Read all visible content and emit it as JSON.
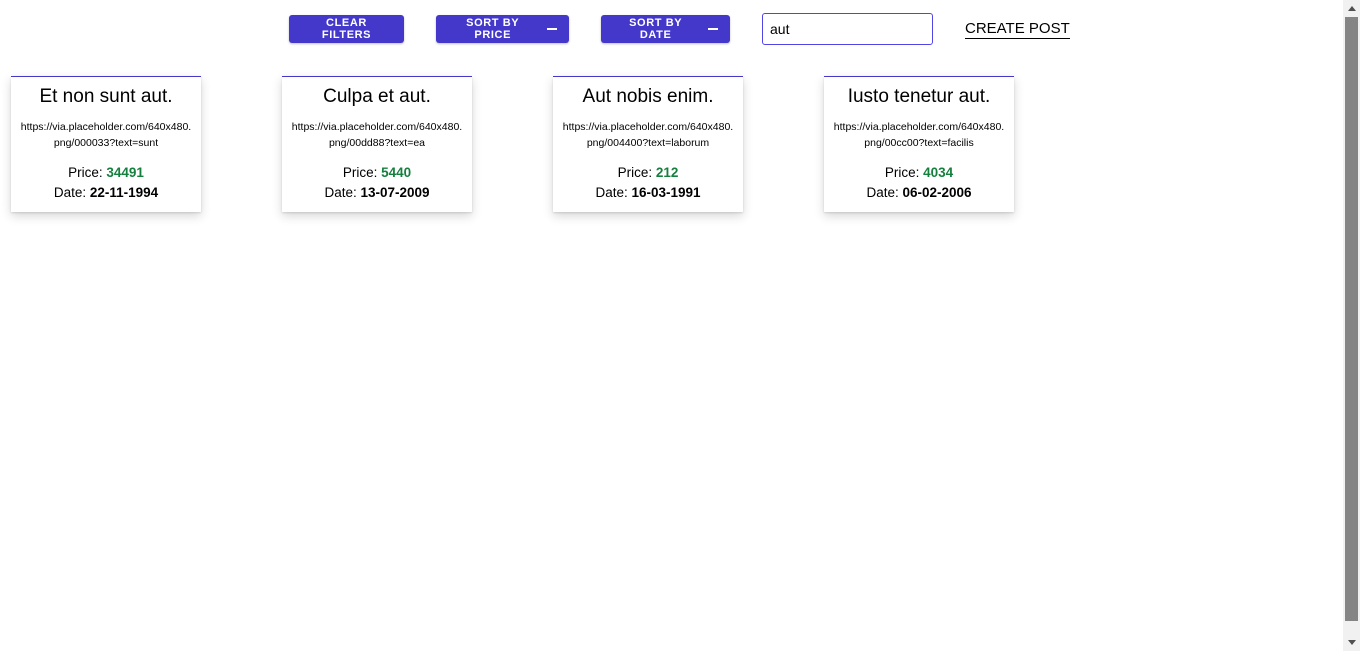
{
  "colors": {
    "button_bg": "#4338ca",
    "price_value": "#15803d",
    "search_border": "#4f46e5",
    "card_accent": "#4338ca"
  },
  "toolbar": {
    "clear_label": "CLEAR FILTERS",
    "sort_price_label": "SORT BY PRICE",
    "sort_date_label": "SORT BY DATE",
    "search_value": "aut",
    "create_label": "CREATE POST"
  },
  "cards": [
    {
      "title": "Et non sunt aut.",
      "url": "https://via.placeholder.com/640x480.png/000033?text=sunt",
      "price_label": "Price: ",
      "price": "34491",
      "date_label": "Date: ",
      "date": "22-11-1994"
    },
    {
      "title": "Culpa et aut.",
      "url": "https://via.placeholder.com/640x480.png/00dd88?text=ea",
      "price_label": "Price: ",
      "price": "5440",
      "date_label": "Date: ",
      "date": "13-07-2009"
    },
    {
      "title": "Aut nobis enim.",
      "url": "https://via.placeholder.com/640x480.png/004400?text=laborum",
      "price_label": "Price: ",
      "price": "212",
      "date_label": "Date: ",
      "date": "16-03-1991"
    },
    {
      "title": "Iusto tenetur aut.",
      "url": "https://via.placeholder.com/640x480.png/00cc00?text=facilis",
      "price_label": "Price: ",
      "price": "4034",
      "date_label": "Date: ",
      "date": "06-02-2006"
    }
  ]
}
